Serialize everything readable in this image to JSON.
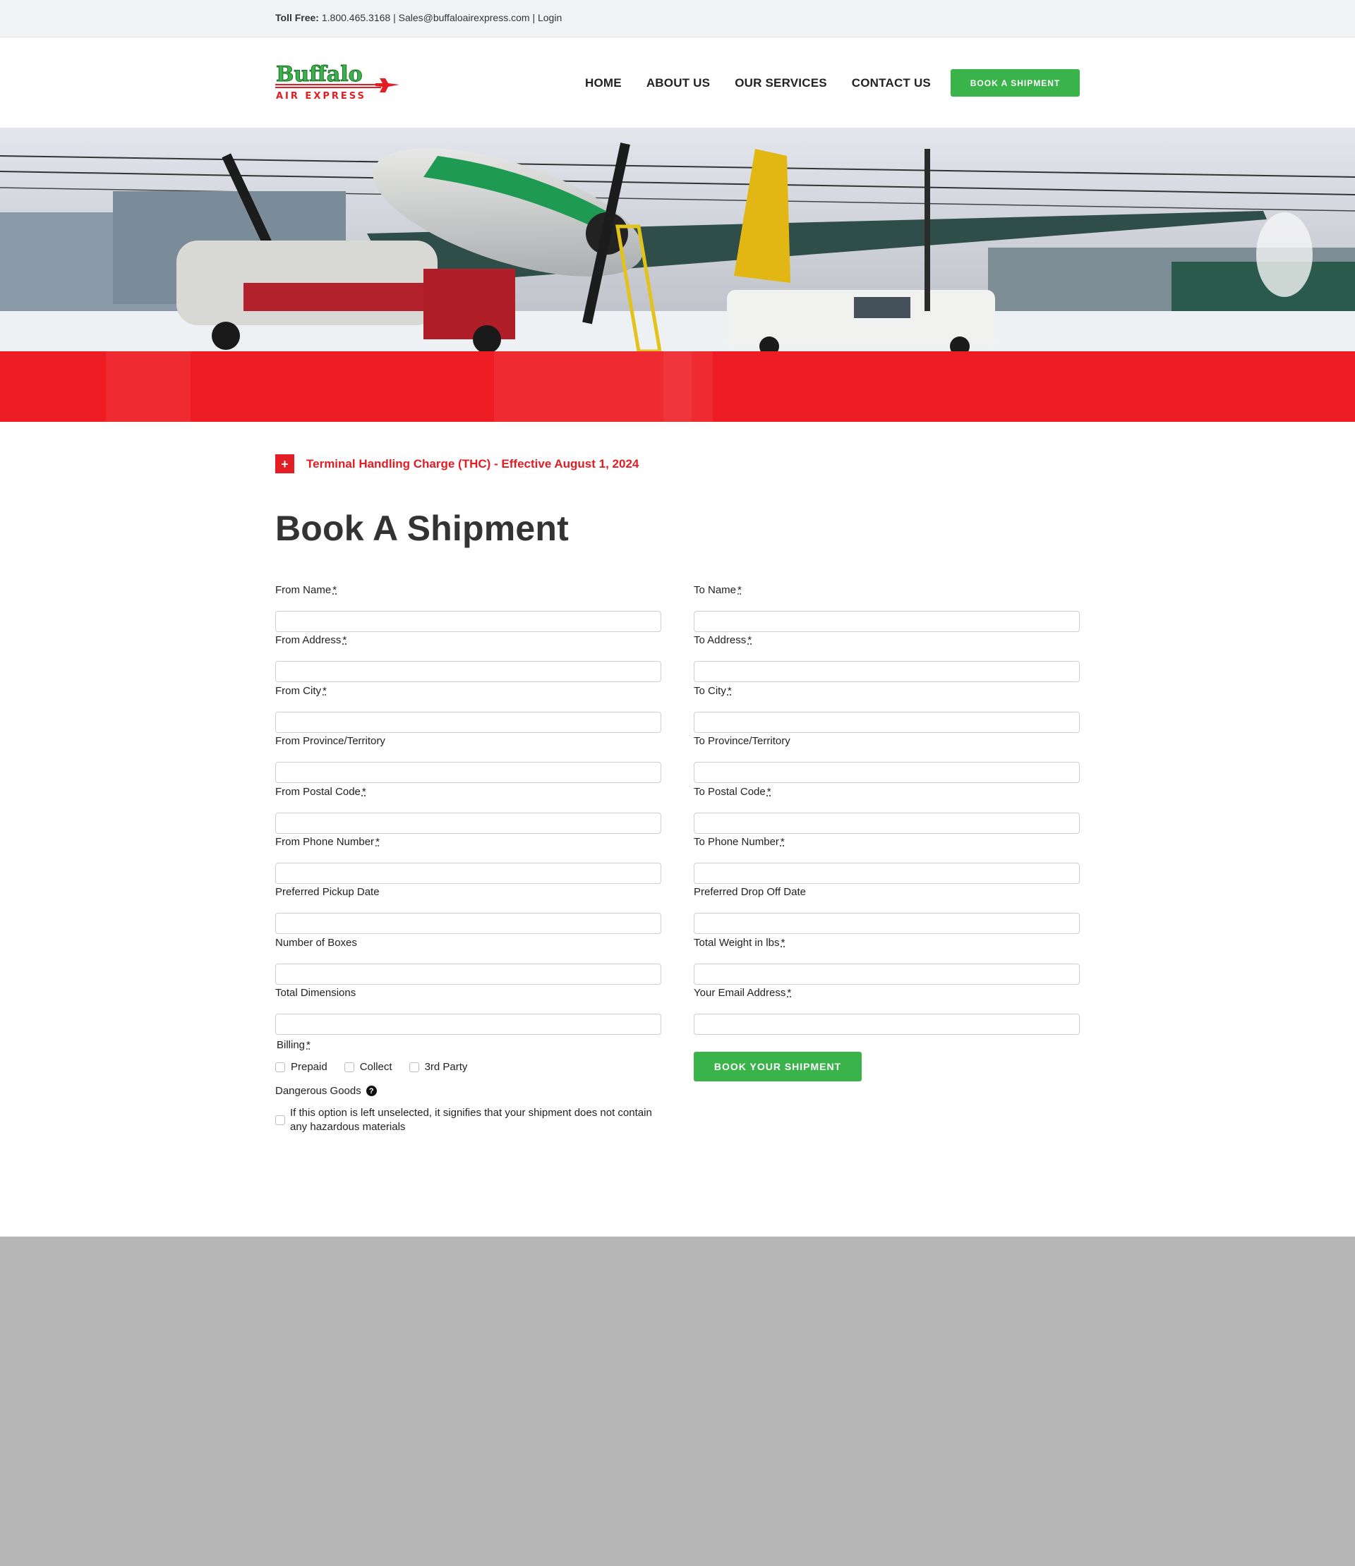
{
  "topbar": {
    "toll_free_label": "Toll Free:",
    "phone": "1.800.465.3168",
    "separator": "|",
    "email": "Sales@buffaloairexpress.com",
    "login": "Login"
  },
  "logo": {
    "word": "Buffalo",
    "sub": "AIR EXPRESS"
  },
  "nav": {
    "items": [
      "HOME",
      "ABOUT US",
      "OUR SERVICES",
      "CONTACT US"
    ],
    "cta": "BOOK A SHIPMENT"
  },
  "notice": {
    "icon": "+",
    "text": "Terminal Handling Charge (THC) - Effective August 1, 2024"
  },
  "page_title": "Book A Shipment",
  "form": {
    "left": [
      {
        "label": "From Name",
        "required": "*"
      },
      {
        "label": "From Address",
        "required": "*"
      },
      {
        "label": "From City",
        "required": "*"
      },
      {
        "label": "From Province/Territory",
        "required": ""
      },
      {
        "label": "From Postal Code",
        "required": "*"
      },
      {
        "label": "From Phone Number",
        "required": "*"
      },
      {
        "label": "Preferred Pickup Date",
        "required": ""
      },
      {
        "label": "Number of Boxes",
        "required": ""
      },
      {
        "label": "Total Dimensions",
        "required": ""
      }
    ],
    "right": [
      {
        "label": "To Name",
        "required": "*"
      },
      {
        "label": "To Address",
        "required": "*"
      },
      {
        "label": "To City",
        "required": "*"
      },
      {
        "label": "To Province/Territory",
        "required": ""
      },
      {
        "label": "To Postal Code",
        "required": "*"
      },
      {
        "label": "To Phone Number",
        "required": "*"
      },
      {
        "label": "Preferred Drop Off Date",
        "required": ""
      },
      {
        "label": "Total Weight in lbs",
        "required": "*"
      },
      {
        "label": "Your Email Address",
        "required": "*"
      }
    ],
    "billing": {
      "label": "Billing",
      "required": "*",
      "options": [
        "Prepaid",
        "Collect",
        "3rd Party"
      ]
    },
    "dangerous_goods": {
      "label": "Dangerous Goods",
      "help_icon": "question-circle-icon",
      "option_text": "If this option is left unselected, it signifies that your shipment does not contain any hazardous materials"
    },
    "submit": "BOOK YOUR SHIPMENT"
  },
  "colors": {
    "brand_green": "#3ab34a",
    "brand_red": "#e21d24",
    "topbar_bg": "#f2f3f4",
    "footer_bg": "#b6b6b6"
  }
}
